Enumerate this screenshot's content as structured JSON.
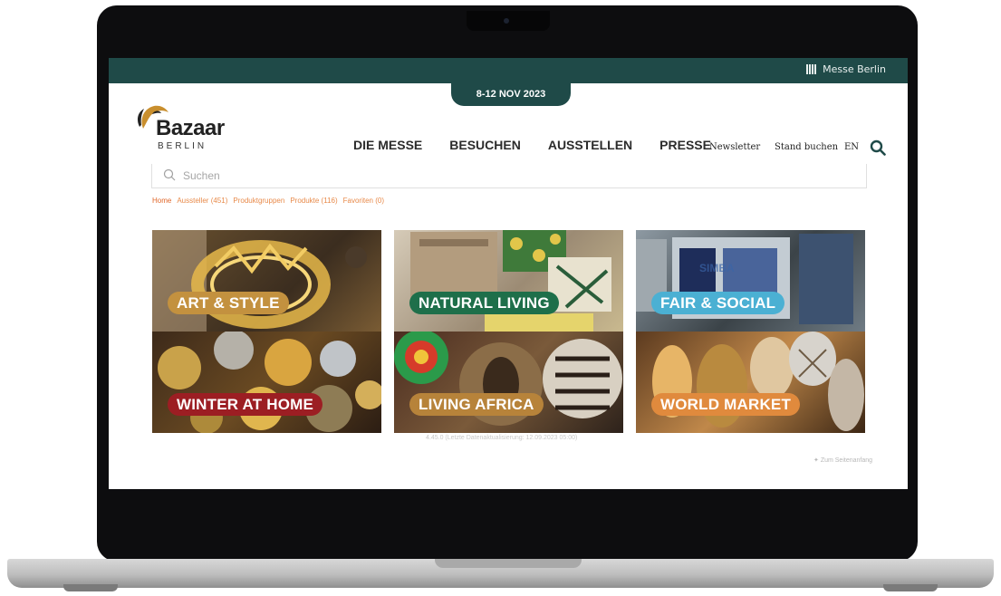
{
  "topbar": {
    "brand": "Messe Berlin"
  },
  "date_tab": "8-12 NOV 2023",
  "logo": {
    "word": "Bazaar",
    "sub": "BERLIN"
  },
  "nav": [
    {
      "label": "DIE MESSE",
      "active": false
    },
    {
      "label": "BESUCHEN",
      "active": true
    },
    {
      "label": "AUSSTELLEN",
      "active": false
    },
    {
      "label": "PRESSE",
      "active": false
    }
  ],
  "utility": {
    "newsletter": "Newsletter",
    "stand": "Stand buchen",
    "lang": "EN"
  },
  "search": {
    "placeholder": "Suchen"
  },
  "breadcrumbs": [
    "Home",
    "Aussteller (451)",
    "Produktgruppen",
    "Produkte (116)",
    "Favoriten (0)"
  ],
  "tiles": [
    {
      "label": "ART & STYLE",
      "color": "#c3913f"
    },
    {
      "label": "NATURAL LIVING",
      "color": "#1e6f4a"
    },
    {
      "label": "FAIR & SOCIAL",
      "color": "#4bb0d3"
    },
    {
      "label": "WINTER AT HOME",
      "color": "#9c1e23"
    },
    {
      "label": "LIVING AFRICA",
      "color": "#b7833a"
    },
    {
      "label": "WORLD MARKET",
      "color": "#e08a3d"
    }
  ],
  "footer_note": "4.45.0 (Letzte Datenaktualisierung: 12.09.2023 05:00)",
  "top_link": "Zum Seitenanfang"
}
